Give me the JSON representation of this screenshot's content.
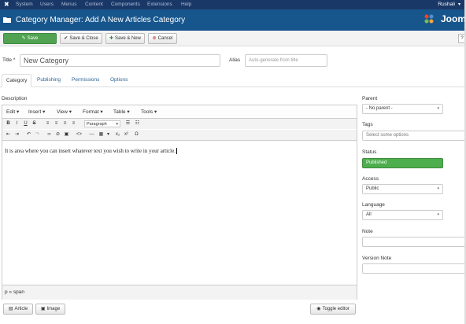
{
  "menubar": {
    "items": [
      "System",
      "Users",
      "Menus",
      "Content",
      "Components",
      "Extensions",
      "Help"
    ],
    "user": "Rushali"
  },
  "header": {
    "title": "Category Manager: Add A New Articles Category",
    "brand": "Joom"
  },
  "toolbar": {
    "save": "Save",
    "save_close": "Save & Close",
    "save_new": "Save & New",
    "cancel": "Cancel"
  },
  "form": {
    "title_label": "Title *",
    "title_value": "New Category",
    "alias_label": "Alias",
    "alias_placeholder": "Auto-generate from title"
  },
  "tabs": [
    "Category",
    "Publishing",
    "Permissions",
    "Options"
  ],
  "editor": {
    "description_label": "Description",
    "menu": [
      "Edit",
      "Insert",
      "View",
      "Format",
      "Table",
      "Tools"
    ],
    "format_select": "Paragraph",
    "content": "It is area where you can insert whatever text you wish to write in your article.",
    "statusbar": "p » span"
  },
  "bottom_buttons": {
    "article": "Article",
    "image": "Image",
    "toggle_editor": "Toggle editor"
  },
  "sidebar": {
    "parent_label": "Parent",
    "parent_value": "- No parent -",
    "tags_label": "Tags",
    "tags_placeholder": "Select some options",
    "status_label": "Status",
    "status_value": "Published",
    "access_label": "Access",
    "access_value": "Public",
    "language_label": "Language",
    "language_value": "All",
    "note_label": "Note",
    "version_note_label": "Version Note"
  },
  "colors": {
    "menubar_bg": "#1a3867",
    "header_bg": "#17568c",
    "save_green": "#51a351",
    "status_green": "#4cae4c"
  }
}
